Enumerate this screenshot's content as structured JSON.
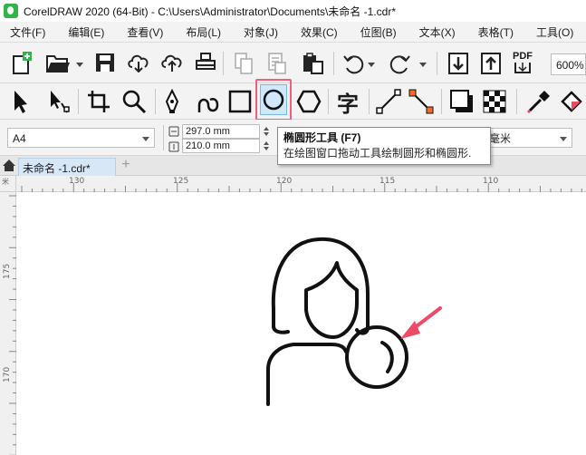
{
  "window": {
    "title": "CorelDRAW 2020 (64-Bit) - C:\\Users\\Administrator\\Documents\\未命名 -1.cdr*",
    "accent": "#2fb54a"
  },
  "menu": [
    {
      "label": "文件(F)"
    },
    {
      "label": "编辑(E)"
    },
    {
      "label": "查看(V)"
    },
    {
      "label": "布局(L)"
    },
    {
      "label": "对象(J)"
    },
    {
      "label": "效果(C)"
    },
    {
      "label": "位图(B)"
    },
    {
      "label": "文本(X)"
    },
    {
      "label": "表格(T)"
    },
    {
      "label": "工具(O)"
    }
  ],
  "standard_toolbar": {
    "icons": [
      "new-document-icon",
      "open-folder-icon",
      "save-icon",
      "cloud-download-icon",
      "cloud-upload-icon",
      "print-icon",
      "copy-icon",
      "paste-icon",
      "clipboard-icon",
      "undo-icon",
      "redo-icon",
      "import-icon",
      "export-icon",
      "pdf-icon"
    ],
    "pdf_label": "PDF",
    "zoom": "600%"
  },
  "toolbox": {
    "tools": [
      "pick-tool-icon",
      "shape-tool-icon",
      "crop-tool-icon",
      "zoom-tool-icon",
      "pen-tool-icon",
      "freehand-tool-icon",
      "rectangle-tool-icon",
      "ellipse-tool-icon",
      "polygon-tool-icon",
      "text-tool-icon",
      "line-tool-icon",
      "connector-tool-icon",
      "drop-shadow-tool-icon",
      "transparency-tool-icon",
      "eyedropper-tool-icon",
      "fill-tool-icon"
    ],
    "active_tool": "ellipse-tool-icon",
    "text_tool_glyph": "字",
    "highlight_color": "#f0607a"
  },
  "property_bar": {
    "page_size": "A4",
    "width": "297.0 mm",
    "height": "210.0 mm",
    "units_partial": "毫米"
  },
  "tooltip": {
    "title": "椭圆形工具 (F7)",
    "description": "在绘图窗口拖动工具绘制圆形和椭圆形."
  },
  "document_tab": {
    "label": "未命名 -1.cdr*",
    "add_label": "+"
  },
  "rulers": {
    "top_ticks": [
      "130",
      "125",
      "120",
      "115",
      "110"
    ],
    "left_ticks": [
      "175",
      "170"
    ],
    "corner_label": "米"
  },
  "canvas": {
    "illustration": "woman-with-magnifier-outline",
    "arrow_color": "#ef4b67"
  }
}
